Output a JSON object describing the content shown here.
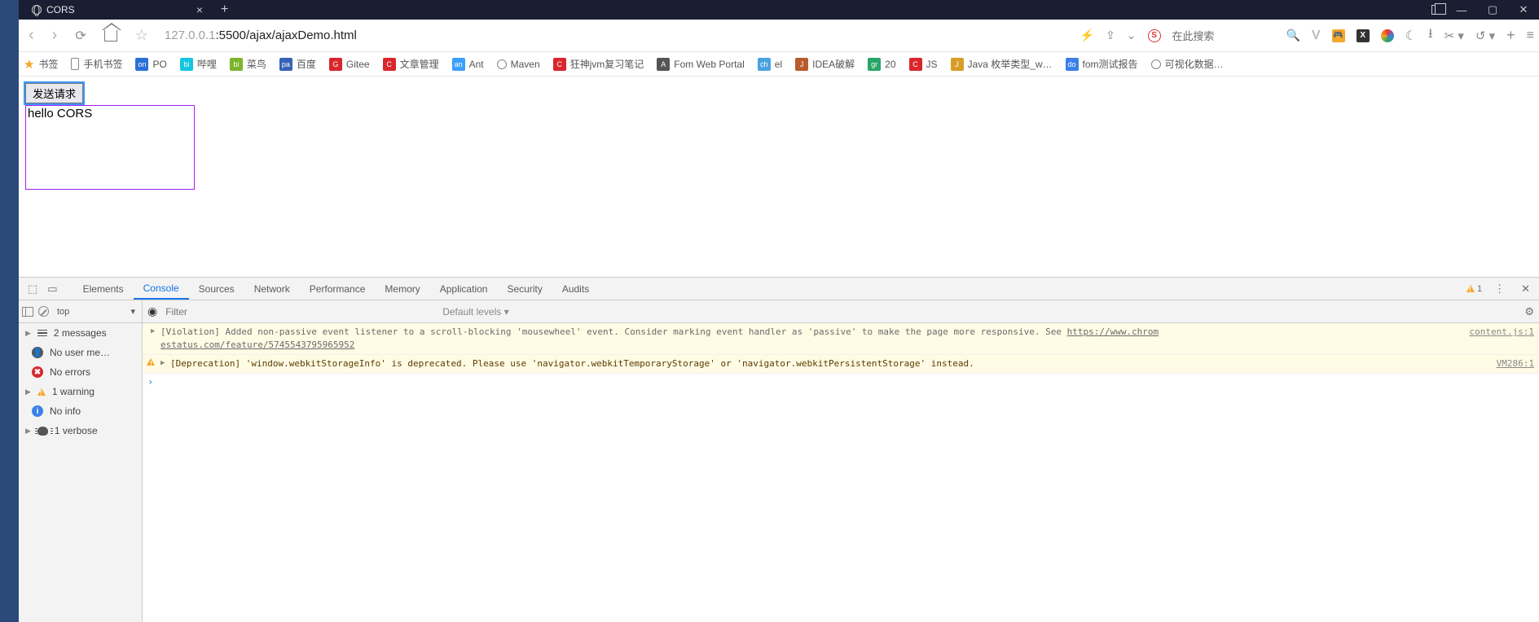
{
  "window": {
    "tab_title": "CORS",
    "titlebar_icons": {
      "fullscreen": "⛶",
      "min": "—",
      "max": "▢",
      "close": "✕"
    }
  },
  "addressbar": {
    "url_grey_prefix": "127.0.0.1",
    "url_dark": ":5500/ajax/ajaxDemo.html",
    "search_placeholder": "在此搜索"
  },
  "bookmarks": [
    {
      "label": "书签",
      "icon": "star"
    },
    {
      "label": "手机书签",
      "icon": "phone"
    },
    {
      "label": "PO",
      "icon": "on",
      "bg": "#2a6fd6"
    },
    {
      "label": "哔哩",
      "icon": "bili",
      "bg": "#14c5e0"
    },
    {
      "label": "菜鸟",
      "icon": "bird",
      "bg": "#7bb52b"
    },
    {
      "label": "百度",
      "icon": "paw",
      "bg": "#3763b7"
    },
    {
      "label": "Gitee",
      "icon": "G",
      "bg": "#d9262c"
    },
    {
      "label": "文章管理",
      "icon": "C",
      "bg": "#d9262c"
    },
    {
      "label": "Ant",
      "icon": "ant",
      "bg": "#3aa0ff"
    },
    {
      "label": "Maven",
      "icon": "globe"
    },
    {
      "label": "狂神jvm复习笔记",
      "icon": "C",
      "bg": "#d9262c"
    },
    {
      "label": "Fom Web Portal",
      "icon": "A",
      "bg": "#555"
    },
    {
      "label": "el",
      "icon": "check",
      "bg": "#4aa3df"
    },
    {
      "label": "IDEA破解",
      "icon": "J",
      "bg": "#b85b2d"
    },
    {
      "label": "20",
      "icon": "grid",
      "bg": "#29a567"
    },
    {
      "label": "JS",
      "icon": "C",
      "bg": "#d9262c"
    },
    {
      "label": "Java 枚举类型_w…",
      "icon": "J",
      "bg": "#d89c27"
    },
    {
      "label": "fom测试报告",
      "icon": "doc",
      "bg": "#3a80e8"
    },
    {
      "label": "可视化数据…",
      "icon": "globe"
    }
  ],
  "page": {
    "button_label": "发送请求",
    "result_text": "hello CORS"
  },
  "devtools": {
    "tabs": [
      "Elements",
      "Console",
      "Sources",
      "Network",
      "Performance",
      "Memory",
      "Application",
      "Security",
      "Audits"
    ],
    "active_tab": "Console",
    "warn_count": "1",
    "context_select": "top",
    "filter_placeholder": "Filter",
    "levels_label": "Default levels ▾",
    "sidebar": [
      {
        "label": "2 messages",
        "icon": "lines",
        "expandable": true
      },
      {
        "label": "No user me…",
        "icon": "user",
        "bg": "#555"
      },
      {
        "label": "No errors",
        "icon": "err",
        "bg": "#d9262c"
      },
      {
        "label": "1 warning",
        "icon": "warn",
        "expandable": true
      },
      {
        "label": "No info",
        "icon": "info",
        "bg": "#3a80e8"
      },
      {
        "label": "1 verbose",
        "icon": "bug",
        "expandable": true
      }
    ],
    "logs": [
      {
        "kind": "violation",
        "text": "[Violation] Added non-passive event listener to a scroll-blocking 'mousewheel' event. Consider marking event handler as 'passive' to make the page more responsive. See ",
        "link": "https://www.chrom",
        "text2": "estatus.com/feature/5745543795965952",
        "src": "content.js:1"
      },
      {
        "kind": "warning",
        "text": "[Deprecation] 'window.webkitStorageInfo' is deprecated. Please use 'navigator.webkitTemporaryStorage' or 'navigator.webkitPersistentStorage' instead.",
        "src": "VM286:1"
      }
    ]
  },
  "watermark": ""
}
